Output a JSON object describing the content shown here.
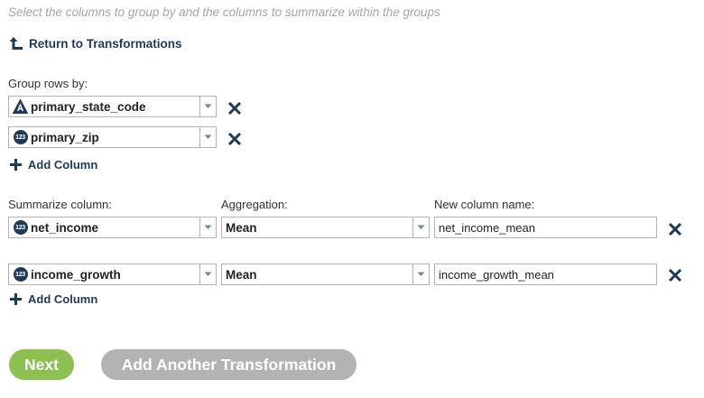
{
  "instructions": "Select the columns to group by and the columns to summarize within the groups",
  "return_link": {
    "label": "Return to Transformations",
    "icon": "arrow-up-return-icon"
  },
  "group": {
    "label": "Group rows by:",
    "rows": [
      {
        "column": "primary_state_code",
        "type_icon": "string-type-icon"
      },
      {
        "column": "primary_zip",
        "type_icon": "numeric-type-icon",
        "type_text": "123"
      }
    ],
    "add_label": "Add Column"
  },
  "summarize": {
    "column_label": "Summarize column:",
    "aggregation_label": "Aggregation:",
    "new_name_label": "New column name:",
    "rows": [
      {
        "column": "net_income",
        "type_icon": "numeric-type-icon",
        "type_text": "123",
        "aggregation": "Mean",
        "new_name": "net_income_mean"
      },
      {
        "column": "income_growth",
        "type_icon": "numeric-type-icon",
        "type_text": "123",
        "aggregation": "Mean",
        "new_name": "income_growth_mean"
      }
    ],
    "add_label": "Add Column"
  },
  "buttons": {
    "next": "Next",
    "add_another": "Add Another Transformation"
  },
  "colors": {
    "brand_navy": "#1f3a56",
    "next_green": "#8cc152",
    "disabled_gray": "#b3b3b3",
    "border": "#b4b4b4"
  }
}
